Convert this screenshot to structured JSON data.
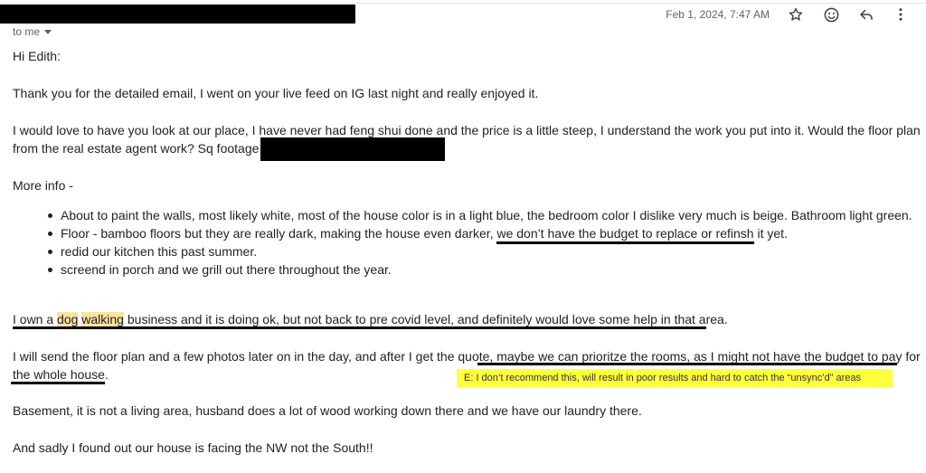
{
  "header": {
    "date": "Feb 1, 2024, 7:47 AM",
    "to_me": "to me",
    "icons": [
      "star-icon",
      "emoji-icon",
      "reply-icon",
      "more-vert-icon"
    ]
  },
  "body": {
    "greeting": "Hi Edith:",
    "p1": "Thank you for the detailed email, I went on your live feed on IG last night and really enjoyed it.",
    "p2_line1": "I would love to have you look at our place, I have never had feng shui done and the price is a little steep, I understand the work you put into it.  Would the floor plan",
    "p2_line2": "from the real estate agent work?   Sq footage",
    "more_info": "More info -",
    "bullets": [
      {
        "pre": "About to paint the walls, most likely white, most of the house color is in a light blue, the bedroom color I dislike very much is beige.  Bathroom light green.",
        "ul": "",
        "post": ""
      },
      {
        "pre": "Floor -  bamboo floors but they are really dark, making the house even darker, ",
        "ul": "we don’t have the budget to replace or refinsh",
        "post": " it yet."
      },
      {
        "pre": "redid our kitchen this past summer.",
        "ul": "",
        "post": ""
      },
      {
        "pre": "screend in porch and we grill out there throughout the year.",
        "ul": "",
        "post": ""
      }
    ],
    "p3": {
      "pre": "I own a ",
      "hl1": "dog",
      "hl2": "walking",
      "post": " business and it is doing ok, but not back to pre covid level, and definitely would love some help in that area."
    },
    "p4_line1_pre": "I will send the floor plan and a few photos later on in the day, and after I get the quote,",
    "p4_line1_ul": " maybe we can prioritze the rooms, as I might not have the budget to pay for",
    "p4_line2": "the whole house.",
    "note": "E: I don’t recommend this, will result in poor results and hard to catch the “unsync’d” areas",
    "p5": "Basement, it is not a living area, husband does a lot of wood working down there and we have our laundry there.",
    "p6": "And sadly I found out our house is facing the NW not the South!!"
  },
  "colors": {
    "highlight": "#fbe3a0",
    "note_bg": "#ffff3b",
    "redaction": "#000000",
    "muted_text": "#5f6368"
  }
}
